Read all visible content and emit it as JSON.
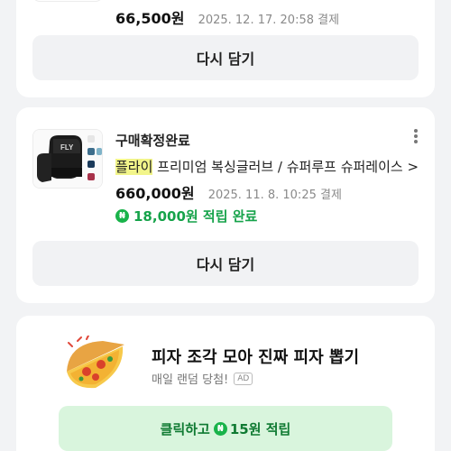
{
  "orders": [
    {
      "price": "66,500원",
      "paid": "2025. 12. 17. 20:58 결제",
      "rebuy_label": "다시 담기"
    },
    {
      "status": "구매확정완료",
      "brand": "플라이",
      "product_rest": " 프리미엄 복싱글러브 / 슈퍼루프 슈퍼레이스 >",
      "price": "660,000원",
      "paid": "2025. 11. 8. 10:25 결제",
      "points": "18,000원 적립 완료",
      "rebuy_label": "다시 담기",
      "thumb_logo": "FLY"
    }
  ],
  "ad": {
    "title": "피자 조각 모아 진짜 피자 뽑기",
    "subtitle": "매일 랜덤 당첨!",
    "badge": "AD",
    "button_prefix": "클릭하고",
    "button_suffix": "15원 적립"
  },
  "coin_symbol": "₦",
  "colors": {
    "accent_green": "#16a34a",
    "highlight": "#f2f58a",
    "reward_bg": "#d9f5dd"
  },
  "icons": [
    "more-vertical-icon",
    "naver-pay-coin-icon",
    "pizza-icon"
  ]
}
